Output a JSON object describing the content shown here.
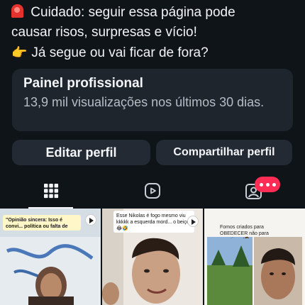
{
  "bio": {
    "line1": "Cuidado: seguir essa página pode",
    "line2": "causar risos, surpresas e vício!",
    "line3": "Já segue ou vai ficar de fora?"
  },
  "panel": {
    "title": "Painel profissional",
    "subtitle": "13,9 mil visualizações nos últimos 30 dias."
  },
  "buttons": {
    "edit": "Editar perfil",
    "share": "Compartilhar perfil"
  },
  "tabs": [
    {
      "icon": "grid-icon"
    },
    {
      "icon": "reels-icon"
    },
    {
      "icon": "tagged-icon"
    }
  ],
  "posts": [
    {
      "caption": "\"Opinião sincera: Isso é convi... política ou falta de rumo me..."
    },
    {
      "caption": "Esse Nikolas é fogo mesmo viu kkkkk a esquerda mord... o beiço 😂🤣"
    },
    {
      "caption": "Fomos criados para OBEDECER não para questionar!🧑‍⚖️"
    }
  ]
}
